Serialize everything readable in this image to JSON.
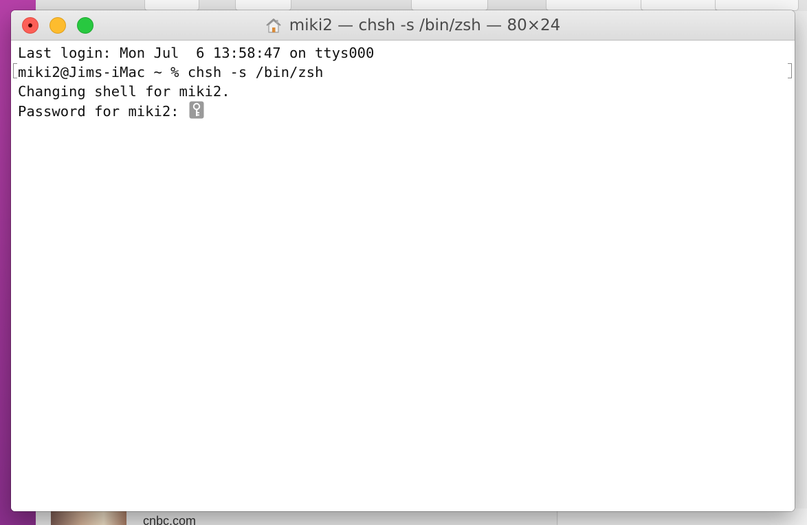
{
  "window": {
    "title": "miki2 — chsh -s /bin/zsh — 80×24",
    "title_icon": "home-icon"
  },
  "terminal": {
    "lines": [
      "Last login: Mon Jul  6 13:58:47 on ttys000",
      "miki2@Jims-iMac ~ % chsh -s /bin/zsh",
      "Changing shell for miki2.",
      "Password for miki2: "
    ],
    "password_icon": "key-icon"
  },
  "background_window": {
    "visible_text": "cnbc.com"
  },
  "colors": {
    "close": "#fc5f57",
    "minimize": "#fdbc2e",
    "maximize": "#28c840",
    "desktop": "#b640a8"
  }
}
